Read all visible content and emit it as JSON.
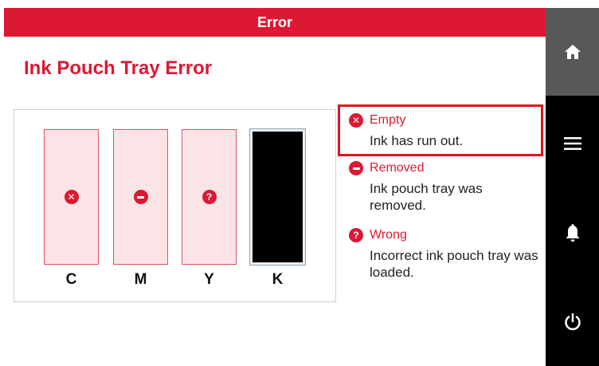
{
  "header": {
    "title": "Error"
  },
  "page": {
    "title": "Ink Pouch Tray Error"
  },
  "slots": [
    {
      "label": "C",
      "status": "empty",
      "icon": "x-circle-icon"
    },
    {
      "label": "M",
      "status": "removed",
      "icon": "minus-circle-icon"
    },
    {
      "label": "Y",
      "status": "wrong",
      "icon": "question-circle-icon"
    },
    {
      "label": "K",
      "status": "ok"
    }
  ],
  "legend": [
    {
      "title": "Empty",
      "description": "Ink has run out.",
      "icon": "x-circle-icon"
    },
    {
      "title": "Removed",
      "description": "Ink pouch tray was removed.",
      "icon": "minus-circle-icon"
    },
    {
      "title": "Wrong",
      "description": "Incorrect ink pouch tray was loaded.",
      "icon": "question-circle-icon"
    }
  ],
  "sidebar": {
    "items": [
      {
        "name": "home",
        "icon": "home-icon"
      },
      {
        "name": "menu",
        "icon": "menu-icon"
      },
      {
        "name": "notifications",
        "icon": "bell-icon"
      },
      {
        "name": "power",
        "icon": "power-icon"
      }
    ]
  },
  "colors": {
    "accent": "#dd1832",
    "slot_fill": "#fbe4e6",
    "sidebar": "#000000",
    "home_button": "#585858"
  }
}
